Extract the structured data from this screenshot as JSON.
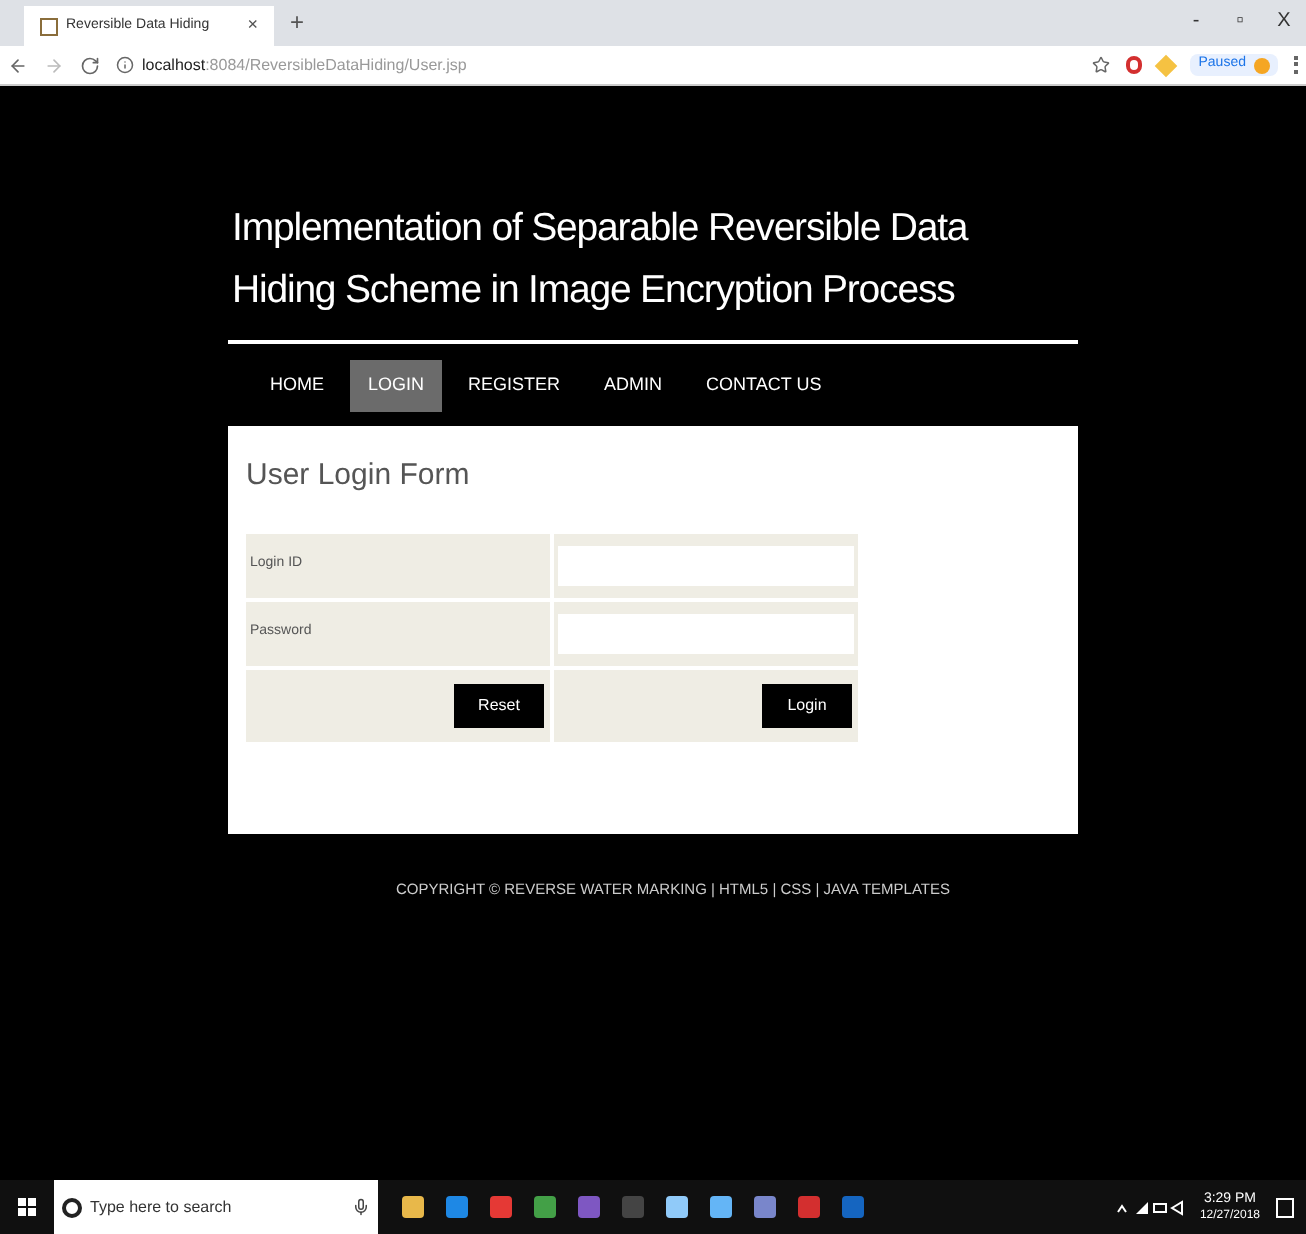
{
  "browser": {
    "tab_title": "Reversible Data Hiding",
    "tab_close": "×",
    "new_tab": "+",
    "url_host": "localhost",
    "url_path": ":8084/ReversibleDataHiding/User.jsp",
    "profile_label": "Paused",
    "window_controls": [
      "-",
      "▫",
      "X"
    ]
  },
  "site": {
    "title": "Implementation of Separable Reversible Data Hiding Scheme in Image Encryption Process",
    "nav": [
      {
        "label": "HOME",
        "selected": false
      },
      {
        "label": "LOGIN",
        "selected": true
      },
      {
        "label": "REGISTER",
        "selected": false
      },
      {
        "label": "ADMIN",
        "selected": false
      },
      {
        "label": "CONTACT US",
        "selected": false
      }
    ],
    "form": {
      "heading": "User Login Form",
      "fields": [
        {
          "label": "Login ID"
        },
        {
          "label": "Password"
        }
      ],
      "buttons": [
        "Reset",
        "Login"
      ]
    },
    "footer": "COPYRIGHT © REVERSE WATER MARKING | HTML5 | CSS | JAVA TEMPLATES"
  },
  "taskbar": {
    "search_placeholder": "Type here to search",
    "time": "3:29 PM",
    "date": "12/27/2018"
  }
}
